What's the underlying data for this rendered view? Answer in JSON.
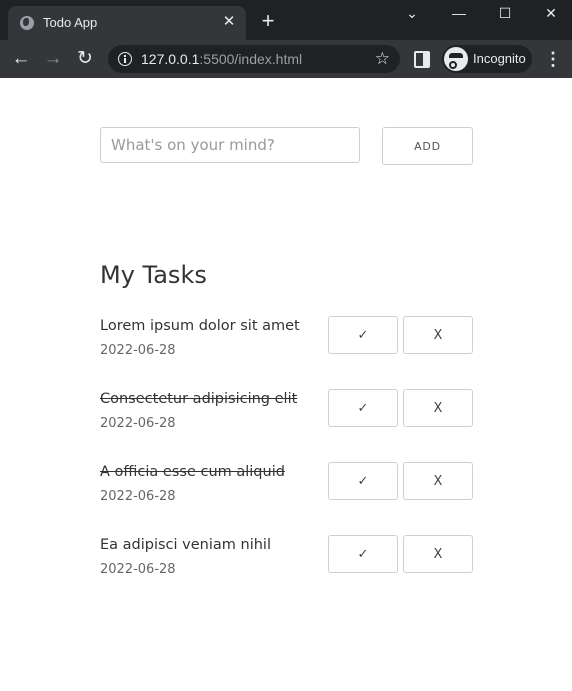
{
  "browser": {
    "tab_title": "Todo App",
    "url_host": "127.0.0.1",
    "url_rest": ":5500/index.html",
    "incognito_label": "Incognito"
  },
  "form": {
    "placeholder": "What's on your mind?",
    "value": "",
    "add_label": "ADD"
  },
  "section_title": "My Tasks",
  "tasks": [
    {
      "name": "Lorem ipsum dolor sit amet",
      "date": "2022-06-28",
      "completed": false,
      "done_label": "✓",
      "delete_label": "X"
    },
    {
      "name": "Consectetur adipisicing elit",
      "date": "2022-06-28",
      "completed": true,
      "done_label": "✓",
      "delete_label": "X"
    },
    {
      "name": "A officia esse cum aliquid",
      "date": "2022-06-28",
      "completed": true,
      "done_label": "✓",
      "delete_label": "X"
    },
    {
      "name": "Ea adipisci veniam nihil",
      "date": "2022-06-28",
      "completed": false,
      "done_label": "✓",
      "delete_label": "X"
    }
  ]
}
